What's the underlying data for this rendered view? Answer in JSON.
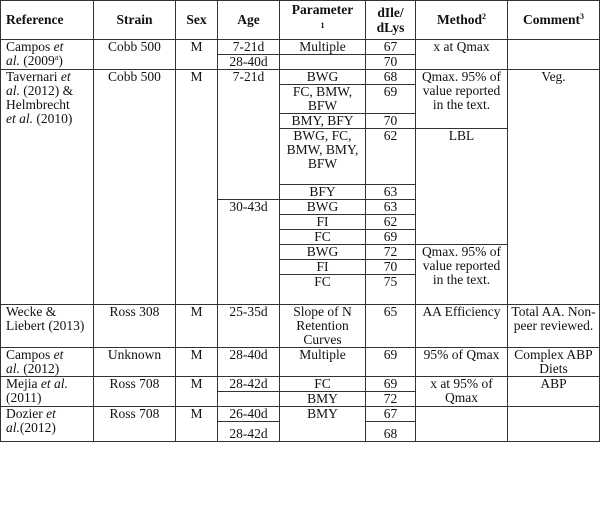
{
  "header": {
    "reference": "Reference",
    "strain": "Strain",
    "sex": "Sex",
    "age": "Age",
    "parameter": "Parameter",
    "parameter_sup": "1",
    "dile_line1": "dIle/",
    "dile_line2": "dLys",
    "method": "Method",
    "method_sup": "2",
    "comment": "Comment",
    "comment_sup": "3"
  },
  "rows": {
    "campos2009": {
      "ref_author": "Campos ",
      "ref_etal_1": "et",
      "ref_etal_2": "al.",
      "ref_year_pre": " (2009",
      "ref_year_sup": "a",
      "ref_year_post": ")",
      "strain": "Cobb 500",
      "sex": "M",
      "ages": [
        "7-21d",
        "28-40d"
      ],
      "parameters": [
        "Multiple",
        ""
      ],
      "ratios": [
        "67",
        "70"
      ],
      "method": "x at Qmax",
      "comment": ""
    },
    "tavernari": {
      "ref_line1_author": "Tavernari ",
      "ref_line1_etal": "et",
      "ref_line2_etal": "al.",
      "ref_line2_rest": " (2012) &",
      "ref_line3": "Helmbrecht",
      "ref_line4_etal": "et al.",
      "ref_line4_rest": " (2010)",
      "strain": "Cobb 500",
      "sex": "M",
      "age_group_1": "7-21d",
      "age_group_2": "30-43d",
      "sub": [
        {
          "parameter": "BWG",
          "ratio": "68"
        },
        {
          "parameter": "FC, BMW, BFW",
          "ratio": "69"
        },
        {
          "parameter": "BMY, BFY",
          "ratio": "70"
        },
        {
          "parameter": "BWG, FC, BMW, BMY, BFW",
          "ratio": "62"
        },
        {
          "parameter": "BFY",
          "ratio": "63"
        },
        {
          "parameter": "BWG",
          "ratio": "63"
        },
        {
          "parameter": "FI",
          "ratio": "62"
        },
        {
          "parameter": "FC",
          "ratio": "69"
        },
        {
          "parameter": "BWG",
          "ratio": "72"
        },
        {
          "parameter": "FI",
          "ratio": "70"
        },
        {
          "parameter": "FC",
          "ratio": "75"
        }
      ],
      "method_1": "Qmax.  95% of value reported in the text.",
      "method_2": "LBL",
      "method_3": "Qmax.  95% of value reported in the text.",
      "comment": "Veg."
    },
    "wecke": {
      "ref": "Wecke & Liebert (2013)",
      "strain": "Ross 308",
      "sex": "M",
      "age": "25-35d",
      "parameter": "Slope of N Retention Curves",
      "ratio": "65",
      "method": "AA Efficiency",
      "comment": "Total AA. Non-peer reviewed."
    },
    "campos2012": {
      "ref_author": "Campos ",
      "ref_etal_1": "et",
      "ref_etal_2": "al.",
      "ref_rest": " (2012)",
      "strain": "Unknown",
      "sex": "M",
      "age": "28-40d",
      "parameter": "Multiple",
      "ratio": "69",
      "method": "95% of Qmax",
      "comment": "Complex ABP Diets"
    },
    "mejia": {
      "ref_author": "Mejia ",
      "ref_etal": "et al.",
      "ref_rest": " (2011)",
      "strain": "Ross 708",
      "sex": "M",
      "ages": [
        "28-42d",
        ""
      ],
      "parameters": [
        "FC",
        "BMY"
      ],
      "ratios": [
        "69",
        "72"
      ],
      "method": "x at 95% of Qmax",
      "comment": "ABP"
    },
    "dozier": {
      "ref_author": "Dozier ",
      "ref_etal_1": "et",
      "ref_etal_2": "al.",
      "ref_rest": "(2012)",
      "strain": "Ross 708",
      "sex": "M",
      "ages": [
        "26-40d",
        "28-42d"
      ],
      "parameter": "BMY",
      "ratios": [
        "67",
        "68"
      ],
      "method": "",
      "comment": ""
    }
  }
}
